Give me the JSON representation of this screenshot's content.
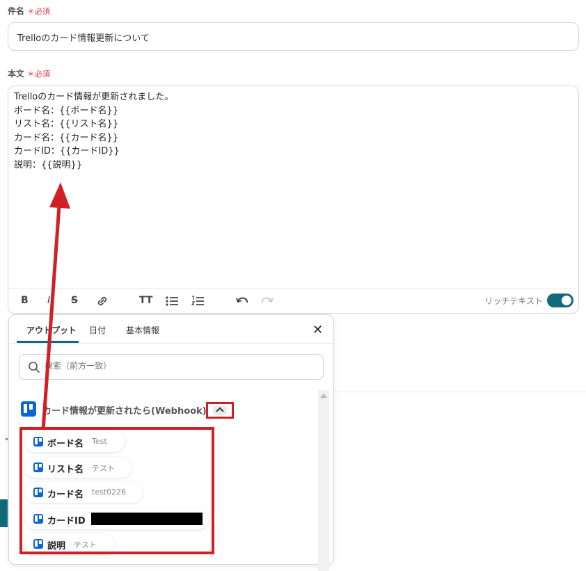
{
  "subject": {
    "label": "件名",
    "required": "＊必須",
    "value": "Trelloのカード情報更新について"
  },
  "body": {
    "label": "本文",
    "required": "＊必須",
    "lines": [
      "Trelloのカード情報が更新されました。",
      "ボード名：{{ボード名}}",
      "リスト名：{{リスト名}}",
      "カード名：{{カード名}}",
      "カードID：{{カードID}}",
      "説明：{{説明}}"
    ]
  },
  "toolbar": {
    "rich_text_label": "リッチテキスト",
    "rich_text_enabled": true
  },
  "popup": {
    "tabs": [
      {
        "label": "アウトプット",
        "active": true
      },
      {
        "label": "日付",
        "active": false
      },
      {
        "label": "基本情報",
        "active": false
      }
    ],
    "close": "✕",
    "search_placeholder": "検索（前方一致）",
    "trigger_title": "カード情報が更新されたら(Webhook)",
    "outputs": [
      {
        "key": "ボード名",
        "value": "Test"
      },
      {
        "key": "リスト名",
        "value": "テスト"
      },
      {
        "key": "カード名",
        "value": "test0226"
      },
      {
        "key": "カードID",
        "value": ""
      },
      {
        "key": "説明",
        "value": "テスト"
      }
    ]
  },
  "colors": {
    "accent": "#116a7b",
    "annotation_red": "#d11f26",
    "required": "#e0334f",
    "trello_blue": "#0a66d8"
  },
  "icons": [
    "bold-icon",
    "italic-icon",
    "strikethrough-icon",
    "link-icon",
    "text-size-icon",
    "bullet-list-icon",
    "numbered-list-icon",
    "undo-icon",
    "redo-icon",
    "close-icon",
    "search-icon",
    "chevron-up-icon",
    "trello-icon"
  ]
}
